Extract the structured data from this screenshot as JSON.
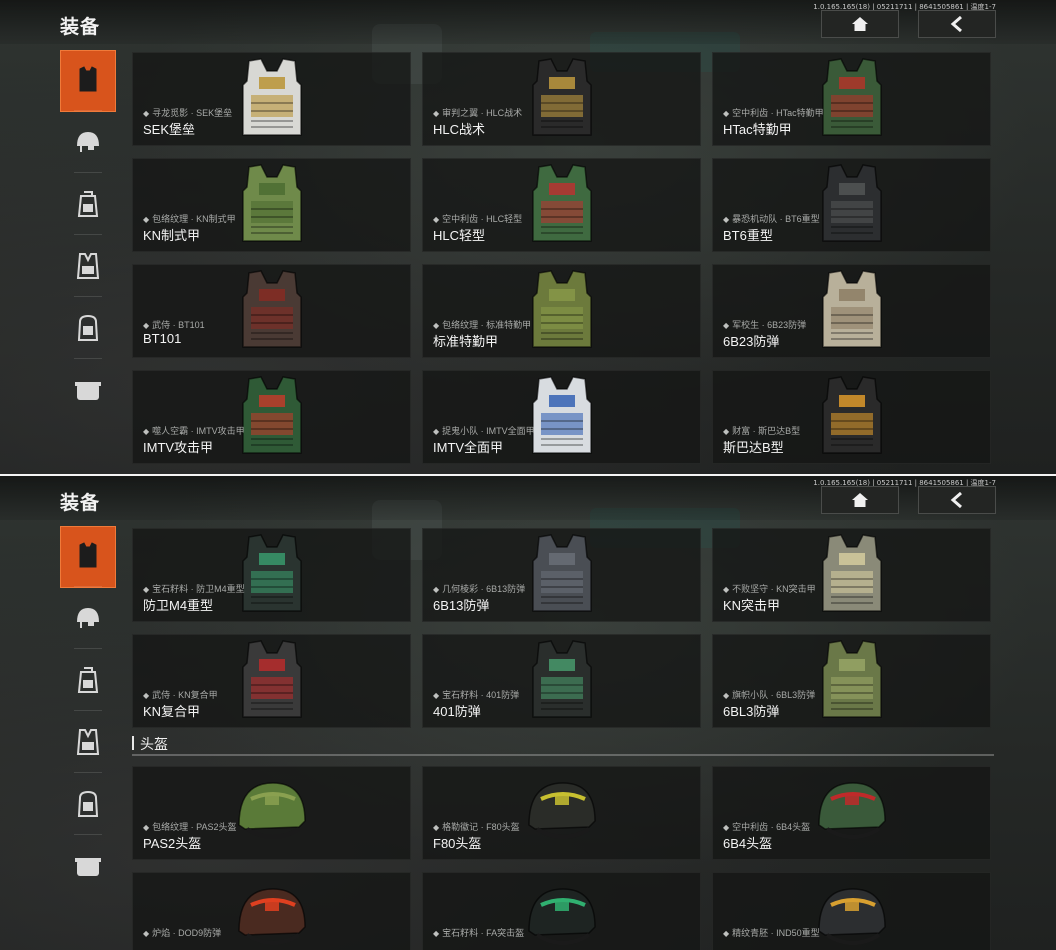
{
  "panel1": {
    "title": "装备",
    "version": "1.0.165.165(18) | 05211711 | 8641505861 | 温度1-7",
    "sidebar": [
      "armor-icon",
      "helmet-icon",
      "backpack-icon",
      "vest-icon",
      "pack-icon",
      "pouch-icon",
      "boots-icon"
    ],
    "cards": [
      {
        "sub": "寻龙觅影 · SEK堡垒",
        "name": "SEK堡垒",
        "color": "#d8d8d4",
        "accent": "#b8902a"
      },
      {
        "sub": "审判之翼 · HLC战术",
        "name": "HLC战术",
        "color": "#2a2a2a",
        "accent": "#c8a040"
      },
      {
        "sub": "空中利齿 · HTac特勤甲",
        "name": "HTac特勤甲",
        "color": "#3a5a38",
        "accent": "#b83228"
      },
      {
        "sub": "包络纹理 · KN制式甲",
        "name": "KN制式甲",
        "color": "#6f8a4a",
        "accent": "#4a6a30"
      },
      {
        "sub": "空中利齿 · HLC轻型",
        "name": "HLC轻型",
        "color": "#3f6a40",
        "accent": "#c03030"
      },
      {
        "sub": "暴恐机动队 · BT6重型",
        "name": "BT6重型",
        "color": "#2c2e30",
        "accent": "#555858"
      },
      {
        "sub": "武侍 · BT101",
        "name": "BT101",
        "color": "#4a3a34",
        "accent": "#8a2a22"
      },
      {
        "sub": "包络纹理 · 标准特勤甲",
        "name": "标准特勤甲",
        "color": "#6c7a3c",
        "accent": "#8a9a48"
      },
      {
        "sub": "军校生 · 6B23防弹",
        "name": "6B23防弹",
        "color": "#b8b09a",
        "accent": "#8a7a60"
      },
      {
        "sub": "噬人空霸 · IMTV攻击甲",
        "name": "IMTV攻击甲",
        "color": "#2f5a36",
        "accent": "#c83a2a"
      },
      {
        "sub": "捉鬼小队 · IMTV全面甲",
        "name": "IMTV全面甲",
        "color": "#d8dce0",
        "accent": "#2a5ab0"
      },
      {
        "sub": "财富 · 斯巴达B型",
        "name": "斯巴达B型",
        "color": "#2a2a2a",
        "accent": "#e8a02a"
      }
    ]
  },
  "panel2": {
    "title": "装备",
    "version": "1.0.165.165(18) | 05211711 | 8641505861 | 温度1-7",
    "armor_cards": [
      {
        "sub": "宝石籽料 · 防卫M4重型",
        "name": "防卫M4重型",
        "color": "#2a3430",
        "accent": "#3aa070"
      },
      {
        "sub": "几何棱彩 · 6B13防弹",
        "name": "6B13防弹",
        "color": "#4a4e54",
        "accent": "#6a7078"
      },
      {
        "sub": "不败坚守 · KN突击甲",
        "name": "KN突击甲",
        "color": "#8a8a78",
        "accent": "#d8cfa0"
      },
      {
        "sub": "武侍 · KN复合甲",
        "name": "KN复合甲",
        "color": "#3a3a3a",
        "accent": "#c02a2a"
      },
      {
        "sub": "宝石籽料 · 401防弹",
        "name": "401防弹",
        "color": "#2a2e2c",
        "accent": "#4aa070"
      },
      {
        "sub": "旗帜小队 · 6BL3防弹",
        "name": "6BL3防弹",
        "color": "#6a7848",
        "accent": "#9aa868"
      }
    ],
    "section_title": "头盔",
    "helmet_cards": [
      {
        "sub": "包络纹理 · PAS2头盔",
        "name": "PAS2头盔",
        "color": "#5a7a38",
        "accent": "#8aa050"
      },
      {
        "sub": "格勒徽记 · F80头盔",
        "name": "F80头盔",
        "color": "#2a2c28",
        "accent": "#c8c030"
      },
      {
        "sub": "空中利齿 · 6B4头盔",
        "name": "6B4头盔",
        "color": "#3a5a3a",
        "accent": "#c02a2a"
      },
      {
        "sub": "炉焰 · DOD9防弹",
        "name": "",
        "color": "#4a2a20",
        "accent": "#e04020"
      },
      {
        "sub": "宝石籽料 · FA突击盔",
        "name": "",
        "color": "#1e2422",
        "accent": "#30b070"
      },
      {
        "sub": "精纹青胚 · IND50重型",
        "name": "",
        "color": "#2c2e30",
        "accent": "#d8a030"
      }
    ]
  },
  "colors": {
    "accent": "#d8541c",
    "card_bg": "#141615"
  }
}
